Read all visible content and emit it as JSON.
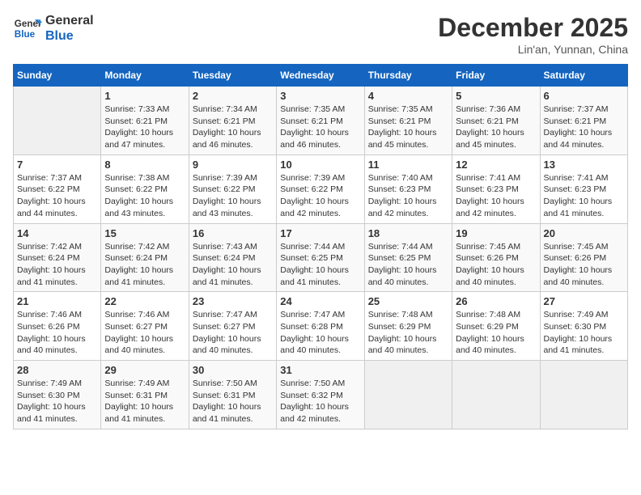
{
  "header": {
    "logo_line1": "General",
    "logo_line2": "Blue",
    "month": "December 2025",
    "location": "Lin'an, Yunnan, China"
  },
  "days_of_week": [
    "Sunday",
    "Monday",
    "Tuesday",
    "Wednesday",
    "Thursday",
    "Friday",
    "Saturday"
  ],
  "weeks": [
    [
      {
        "day": "",
        "content": ""
      },
      {
        "day": "1",
        "content": "Sunrise: 7:33 AM\nSunset: 6:21 PM\nDaylight: 10 hours and 47 minutes."
      },
      {
        "day": "2",
        "content": "Sunrise: 7:34 AM\nSunset: 6:21 PM\nDaylight: 10 hours and 46 minutes."
      },
      {
        "day": "3",
        "content": "Sunrise: 7:35 AM\nSunset: 6:21 PM\nDaylight: 10 hours and 46 minutes."
      },
      {
        "day": "4",
        "content": "Sunrise: 7:35 AM\nSunset: 6:21 PM\nDaylight: 10 hours and 45 minutes."
      },
      {
        "day": "5",
        "content": "Sunrise: 7:36 AM\nSunset: 6:21 PM\nDaylight: 10 hours and 45 minutes."
      },
      {
        "day": "6",
        "content": "Sunrise: 7:37 AM\nSunset: 6:21 PM\nDaylight: 10 hours and 44 minutes."
      }
    ],
    [
      {
        "day": "7",
        "content": "Sunrise: 7:37 AM\nSunset: 6:22 PM\nDaylight: 10 hours and 44 minutes."
      },
      {
        "day": "8",
        "content": "Sunrise: 7:38 AM\nSunset: 6:22 PM\nDaylight: 10 hours and 43 minutes."
      },
      {
        "day": "9",
        "content": "Sunrise: 7:39 AM\nSunset: 6:22 PM\nDaylight: 10 hours and 43 minutes."
      },
      {
        "day": "10",
        "content": "Sunrise: 7:39 AM\nSunset: 6:22 PM\nDaylight: 10 hours and 42 minutes."
      },
      {
        "day": "11",
        "content": "Sunrise: 7:40 AM\nSunset: 6:23 PM\nDaylight: 10 hours and 42 minutes."
      },
      {
        "day": "12",
        "content": "Sunrise: 7:41 AM\nSunset: 6:23 PM\nDaylight: 10 hours and 42 minutes."
      },
      {
        "day": "13",
        "content": "Sunrise: 7:41 AM\nSunset: 6:23 PM\nDaylight: 10 hours and 41 minutes."
      }
    ],
    [
      {
        "day": "14",
        "content": "Sunrise: 7:42 AM\nSunset: 6:24 PM\nDaylight: 10 hours and 41 minutes."
      },
      {
        "day": "15",
        "content": "Sunrise: 7:42 AM\nSunset: 6:24 PM\nDaylight: 10 hours and 41 minutes."
      },
      {
        "day": "16",
        "content": "Sunrise: 7:43 AM\nSunset: 6:24 PM\nDaylight: 10 hours and 41 minutes."
      },
      {
        "day": "17",
        "content": "Sunrise: 7:44 AM\nSunset: 6:25 PM\nDaylight: 10 hours and 41 minutes."
      },
      {
        "day": "18",
        "content": "Sunrise: 7:44 AM\nSunset: 6:25 PM\nDaylight: 10 hours and 40 minutes."
      },
      {
        "day": "19",
        "content": "Sunrise: 7:45 AM\nSunset: 6:26 PM\nDaylight: 10 hours and 40 minutes."
      },
      {
        "day": "20",
        "content": "Sunrise: 7:45 AM\nSunset: 6:26 PM\nDaylight: 10 hours and 40 minutes."
      }
    ],
    [
      {
        "day": "21",
        "content": "Sunrise: 7:46 AM\nSunset: 6:26 PM\nDaylight: 10 hours and 40 minutes."
      },
      {
        "day": "22",
        "content": "Sunrise: 7:46 AM\nSunset: 6:27 PM\nDaylight: 10 hours and 40 minutes."
      },
      {
        "day": "23",
        "content": "Sunrise: 7:47 AM\nSunset: 6:27 PM\nDaylight: 10 hours and 40 minutes."
      },
      {
        "day": "24",
        "content": "Sunrise: 7:47 AM\nSunset: 6:28 PM\nDaylight: 10 hours and 40 minutes."
      },
      {
        "day": "25",
        "content": "Sunrise: 7:48 AM\nSunset: 6:29 PM\nDaylight: 10 hours and 40 minutes."
      },
      {
        "day": "26",
        "content": "Sunrise: 7:48 AM\nSunset: 6:29 PM\nDaylight: 10 hours and 40 minutes."
      },
      {
        "day": "27",
        "content": "Sunrise: 7:49 AM\nSunset: 6:30 PM\nDaylight: 10 hours and 41 minutes."
      }
    ],
    [
      {
        "day": "28",
        "content": "Sunrise: 7:49 AM\nSunset: 6:30 PM\nDaylight: 10 hours and 41 minutes."
      },
      {
        "day": "29",
        "content": "Sunrise: 7:49 AM\nSunset: 6:31 PM\nDaylight: 10 hours and 41 minutes."
      },
      {
        "day": "30",
        "content": "Sunrise: 7:50 AM\nSunset: 6:31 PM\nDaylight: 10 hours and 41 minutes."
      },
      {
        "day": "31",
        "content": "Sunrise: 7:50 AM\nSunset: 6:32 PM\nDaylight: 10 hours and 42 minutes."
      },
      {
        "day": "",
        "content": ""
      },
      {
        "day": "",
        "content": ""
      },
      {
        "day": "",
        "content": ""
      }
    ]
  ]
}
